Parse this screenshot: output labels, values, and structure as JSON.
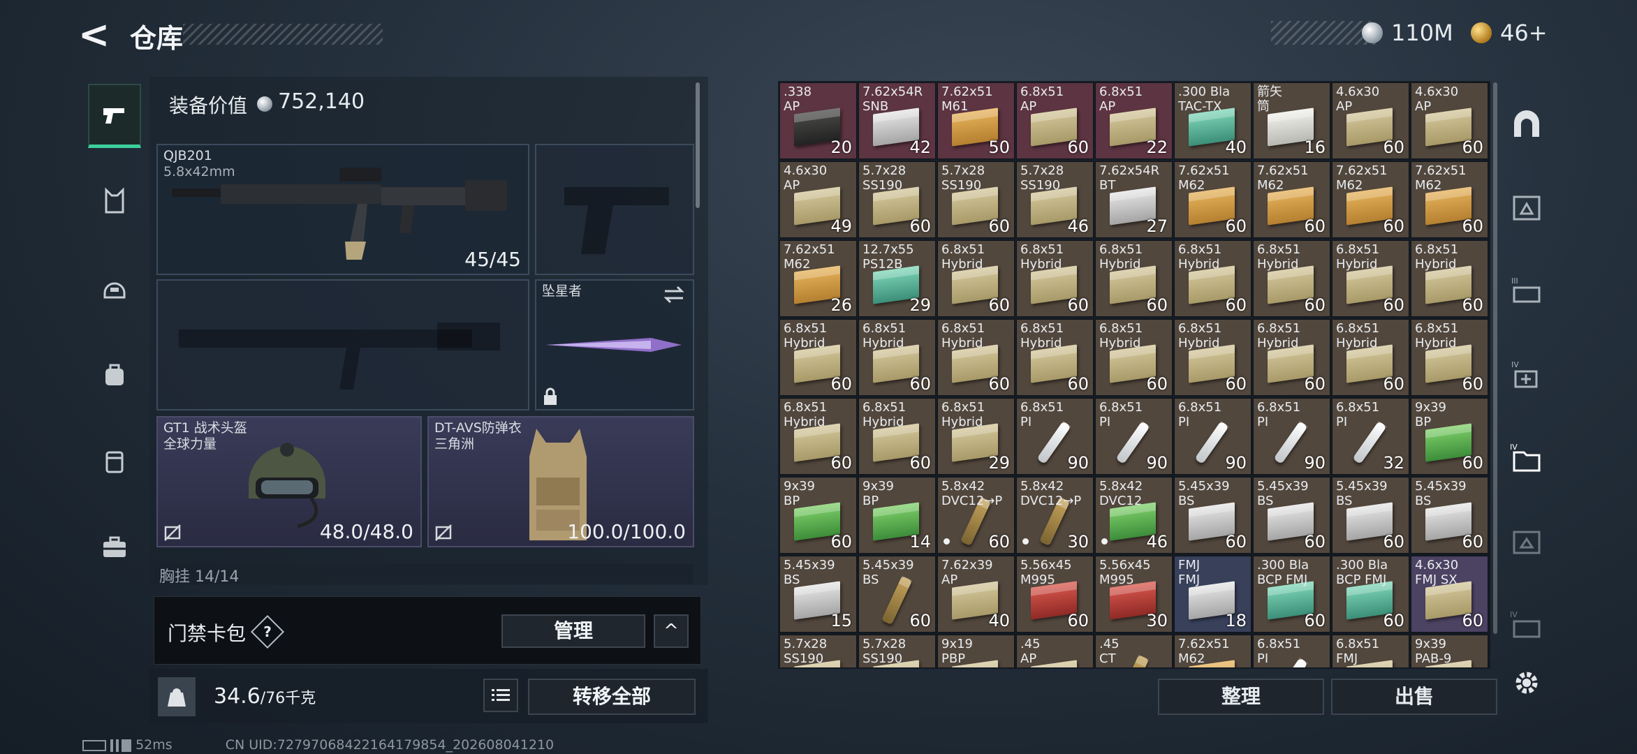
{
  "header": {
    "back_label": "<",
    "title": "仓库"
  },
  "currency": {
    "silver": "110M",
    "gold": "46+"
  },
  "equipment": {
    "value_label": "装备价值",
    "value": "752,140",
    "primary": {
      "name": "QJB201",
      "caliber": "5.8x42mm",
      "ammo": "45/45"
    },
    "melee": {
      "name": "坠星者"
    },
    "helmet": {
      "name": "GT1 战术头盔",
      "sub": "全球力量",
      "durability": "48.0/48.0"
    },
    "armor": {
      "name": "DT-AVS防弹衣",
      "sub": "三角洲",
      "durability": "100.0/100.0"
    },
    "chest_rig": "胸挂 14/14"
  },
  "keycard": {
    "label": "门禁卡包",
    "help": "?",
    "manage": "管理",
    "collapse": "^"
  },
  "carry": {
    "weight": "34.6",
    "capacity": "/76千克",
    "transfer_all": "转移全部"
  },
  "status": {
    "ping": "52ms",
    "uid": "CN UID:72797068422164179854_202608041210"
  },
  "stash": {
    "sort": "整理",
    "sell": "出售",
    "items": [
      {
        "n": ".338\nAP",
        "c": "20",
        "k": "r",
        "t": "blk"
      },
      {
        "n": "7.62x54R\nSNB",
        "c": "42",
        "k": "r",
        "t": "gry"
      },
      {
        "n": "7.62x51\nM61",
        "c": "50",
        "k": "r",
        "t": "yel"
      },
      {
        "n": "6.8x51\nAP",
        "c": "60",
        "k": "r",
        "t": "tan"
      },
      {
        "n": "6.8x51\nAP",
        "c": "22",
        "k": "r",
        "t": "tan"
      },
      {
        "n": ".300 Bla\nTAC-TX",
        "c": "40",
        "k": "d",
        "t": "teal"
      },
      {
        "n": "箭矢\n筒",
        "c": "16",
        "k": "d",
        "t": "wht"
      },
      {
        "n": "4.6x30\nAP",
        "c": "60",
        "k": "d",
        "t": "tan"
      },
      {
        "n": "4.6x30\nAP",
        "c": "60",
        "k": "d",
        "t": "tan"
      },
      {
        "n": "4.6x30\nAP",
        "c": "49",
        "k": "d",
        "t": "tan"
      },
      {
        "n": "5.7x28\nSS190",
        "c": "60",
        "k": "d",
        "t": "tan"
      },
      {
        "n": "5.7x28\nSS190",
        "c": "60",
        "k": "d",
        "t": "tan"
      },
      {
        "n": "5.7x28\nSS190",
        "c": "46",
        "k": "d",
        "t": "tan"
      },
      {
        "n": "7.62x54R\nBT",
        "c": "27",
        "k": "d",
        "t": "gry"
      },
      {
        "n": "7.62x51\nM62",
        "c": "60",
        "k": "d",
        "t": "yel"
      },
      {
        "n": "7.62x51\nM62",
        "c": "60",
        "k": "d",
        "t": "yel"
      },
      {
        "n": "7.62x51\nM62",
        "c": "60",
        "k": "d",
        "t": "yel"
      },
      {
        "n": "7.62x51\nM62",
        "c": "60",
        "k": "d",
        "t": "yel"
      },
      {
        "n": "7.62x51\nM62",
        "c": "26",
        "k": "d",
        "t": "yel"
      },
      {
        "n": "12.7x55\nPS12B",
        "c": "29",
        "k": "d",
        "t": "teal"
      },
      {
        "n": "6.8x51\nHybrid",
        "c": "60",
        "k": "d",
        "t": "tan"
      },
      {
        "n": "6.8x51\nHybrid",
        "c": "60",
        "k": "d",
        "t": "tan"
      },
      {
        "n": "6.8x51\nHybrid",
        "c": "60",
        "k": "d",
        "t": "tan"
      },
      {
        "n": "6.8x51\nHybrid",
        "c": "60",
        "k": "d",
        "t": "tan"
      },
      {
        "n": "6.8x51\nHybrid",
        "c": "60",
        "k": "d",
        "t": "tan"
      },
      {
        "n": "6.8x51\nHybrid",
        "c": "60",
        "k": "d",
        "t": "tan"
      },
      {
        "n": "6.8x51\nHybrid",
        "c": "60",
        "k": "d",
        "t": "tan"
      },
      {
        "n": "6.8x51\nHybrid",
        "c": "60",
        "k": "d",
        "t": "tan"
      },
      {
        "n": "6.8x51\nHybrid",
        "c": "60",
        "k": "d",
        "t": "tan"
      },
      {
        "n": "6.8x51\nHybrid",
        "c": "60",
        "k": "d",
        "t": "tan"
      },
      {
        "n": "6.8x51\nHybrid",
        "c": "60",
        "k": "d",
        "t": "tan"
      },
      {
        "n": "6.8x51\nHybrid",
        "c": "60",
        "k": "d",
        "t": "tan"
      },
      {
        "n": "6.8x51\nHybrid",
        "c": "60",
        "k": "d",
        "t": "tan"
      },
      {
        "n": "6.8x51\nHybrid",
        "c": "60",
        "k": "d",
        "t": "tan"
      },
      {
        "n": "6.8x51\nHybrid",
        "c": "60",
        "k": "d",
        "t": "tan"
      },
      {
        "n": "6.8x51\nHybrid",
        "c": "60",
        "k": "d",
        "t": "tan"
      },
      {
        "n": "6.8x51\nHybrid",
        "c": "60",
        "k": "d",
        "t": "tan"
      },
      {
        "n": "6.8x51\nHybrid",
        "c": "60",
        "k": "d",
        "t": "tan"
      },
      {
        "n": "6.8x51\nHybrid",
        "c": "29",
        "k": "d",
        "t": "tan"
      },
      {
        "n": "6.8x51\nPI",
        "c": "90",
        "k": "d",
        "t": "syr"
      },
      {
        "n": "6.8x51\nPI",
        "c": "90",
        "k": "d",
        "t": "syr"
      },
      {
        "n": "6.8x51\nPI",
        "c": "90",
        "k": "d",
        "t": "syr"
      },
      {
        "n": "6.8x51\nPI",
        "c": "90",
        "k": "d",
        "t": "syr"
      },
      {
        "n": "6.8x51\nPI",
        "c": "32",
        "k": "d",
        "t": "syr"
      },
      {
        "n": "9x39\nBP",
        "c": "60",
        "k": "d",
        "t": "grn"
      },
      {
        "n": "9x39\nBP",
        "c": "60",
        "k": "d",
        "t": "grn"
      },
      {
        "n": "9x39\nBP",
        "c": "14",
        "k": "d",
        "t": "grn"
      },
      {
        "n": "5.8x42\nDVC12→P",
        "c": "60",
        "k": "d",
        "t": "brs",
        "dot": true
      },
      {
        "n": "5.8x42\nDVC12→P",
        "c": "30",
        "k": "d",
        "t": "brs",
        "dot": true
      },
      {
        "n": "5.8x42\nDVC12",
        "c": "46",
        "k": "d",
        "t": "grn",
        "dot": true
      },
      {
        "n": "5.45x39\nBS",
        "c": "60",
        "k": "d",
        "t": "gry"
      },
      {
        "n": "5.45x39\nBS",
        "c": "60",
        "k": "d",
        "t": "gry"
      },
      {
        "n": "5.45x39\nBS",
        "c": "60",
        "k": "d",
        "t": "gry"
      },
      {
        "n": "5.45x39\nBS",
        "c": "60",
        "k": "d",
        "t": "gry"
      },
      {
        "n": "5.45x39\nBS",
        "c": "15",
        "k": "d",
        "t": "gry"
      },
      {
        "n": "5.45x39\nBS",
        "c": "60",
        "k": "d",
        "t": "brs"
      },
      {
        "n": "7.62x39\nAP",
        "c": "40",
        "k": "d",
        "t": "tan"
      },
      {
        "n": "5.56x45\nM995",
        "c": "60",
        "k": "d",
        "t": "red"
      },
      {
        "n": "5.56x45\nM995",
        "c": "30",
        "k": "d",
        "t": "red"
      },
      {
        "n": "FMJ\nFMJ",
        "c": "18",
        "k": "b",
        "t": "gry"
      },
      {
        "n": ".300 Bla\nBCP FMJ",
        "c": "60",
        "k": "d",
        "t": "teal"
      },
      {
        "n": ".300 Bla\nBCP FMJ",
        "c": "60",
        "k": "d",
        "t": "teal"
      },
      {
        "n": "4.6x30\nFMJ SX",
        "c": "60",
        "k": "p",
        "t": "tan"
      },
      {
        "n": "5.7x28\nSS190",
        "c": "",
        "k": "d",
        "t": "tan"
      },
      {
        "n": "5.7x28\nSS190",
        "c": "",
        "k": "d",
        "t": "tan"
      },
      {
        "n": "9x19\nPBP",
        "c": "",
        "k": "d",
        "t": "tan"
      },
      {
        "n": ".45\nAP",
        "c": "",
        "k": "d",
        "t": "tan"
      },
      {
        "n": ".45\nCT",
        "c": "",
        "k": "d",
        "t": "brs"
      },
      {
        "n": "7.62x51\nM62",
        "c": "",
        "k": "d",
        "t": "yel"
      },
      {
        "n": "6.8x51\nPI",
        "c": "",
        "k": "d",
        "t": "syr"
      },
      {
        "n": "6.8x51\nFMJ",
        "c": "",
        "k": "d",
        "t": "tan"
      },
      {
        "n": "9x39\nPAB-9",
        "c": "",
        "k": "d",
        "t": "tan"
      }
    ]
  },
  "colors": {
    "accent": "#3ccf9c",
    "panel": "#19222c"
  },
  "icons": {
    "left_tabs": [
      "pistol-icon",
      "vest-icon",
      "helmet-icon",
      "backpack-icon",
      "pouch-icon",
      "case-icon"
    ],
    "right_tabs": [
      "arch-icon",
      "container-icon",
      "rack-icon",
      "medic-icon",
      "folder-icon",
      "box-icon",
      "crate-icon"
    ]
  }
}
